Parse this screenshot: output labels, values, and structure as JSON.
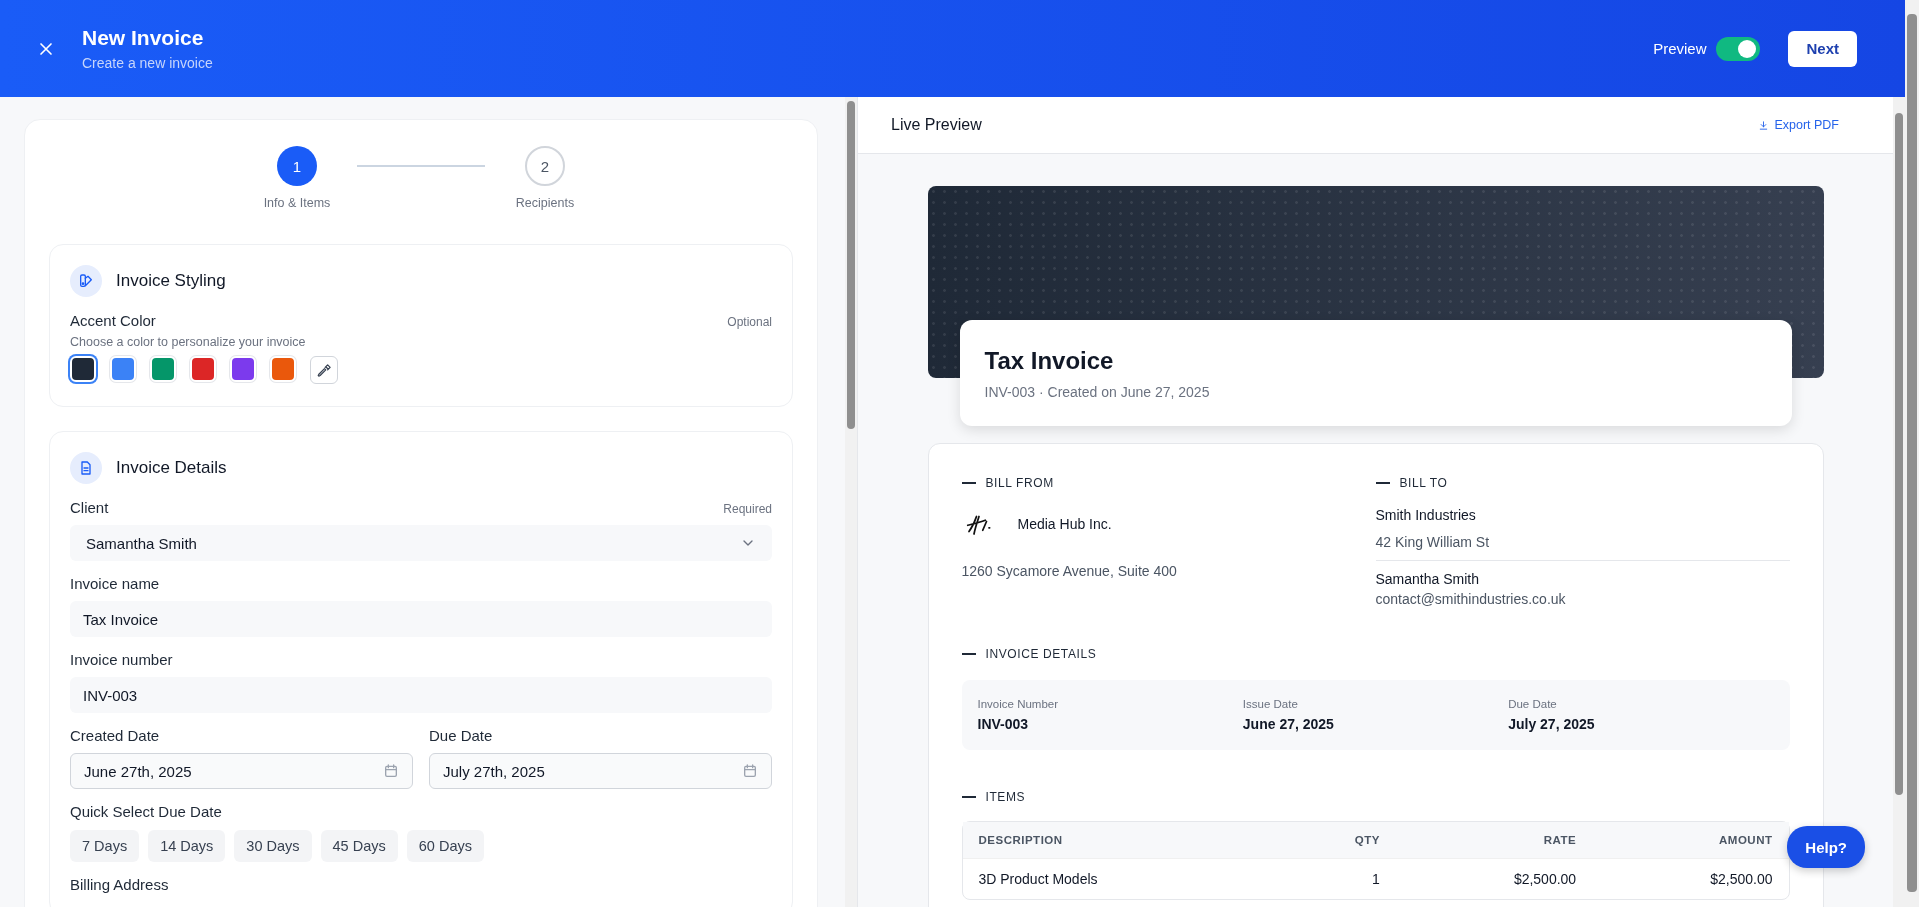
{
  "header": {
    "title": "New Invoice",
    "subtitle": "Create a new invoice",
    "preview_label": "Preview",
    "preview_on": true,
    "next_button": "Next"
  },
  "steps": [
    {
      "number": "1",
      "label": "Info & Items",
      "selected": true
    },
    {
      "number": "2",
      "label": "Recipients",
      "selected": false
    }
  ],
  "styling": {
    "title": "Invoice Styling",
    "accent_label": "Accent Color",
    "accent_note": "Optional",
    "accent_hint": "Choose a color to personalize your invoice",
    "swatches": [
      {
        "kind": "color",
        "color": "#1f2937",
        "selected": true
      },
      {
        "kind": "color",
        "color": "#3b82f6",
        "selected": false
      },
      {
        "kind": "color",
        "color": "#059669",
        "selected": false
      },
      {
        "kind": "color",
        "color": "#dc2626",
        "selected": false
      },
      {
        "kind": "color",
        "color": "#7c3aed",
        "selected": false
      },
      {
        "kind": "color",
        "color": "#ea580c",
        "selected": false
      },
      {
        "kind": "picker",
        "selected": false
      }
    ]
  },
  "details": {
    "title": "Invoice Details",
    "client": {
      "label": "Client",
      "note": "Required",
      "value": "Samantha Smith"
    },
    "invoice_name": {
      "label": "Invoice name",
      "value": "Tax Invoice"
    },
    "invoice_number": {
      "label": "Invoice number",
      "value": "INV-003"
    },
    "created_date": {
      "label": "Created Date",
      "value": "June 27th, 2025"
    },
    "due_date": {
      "label": "Due Date",
      "value": "July 27th, 2025"
    },
    "quick_select": {
      "label": "Quick Select Due Date",
      "options": [
        "7 Days",
        "14 Days",
        "30 Days",
        "45 Days",
        "60 Days"
      ]
    },
    "billing_address": {
      "label": "Billing Address"
    }
  },
  "preview": {
    "title": "Live Preview",
    "export": "Export PDF",
    "invoice_title": "Tax Invoice",
    "invoice_meta": "INV-003 · Created on June 27, 2025",
    "bill_from": {
      "heading": "BILL FROM",
      "company": "Media Hub Inc.",
      "address": "1260 Sycamore Avenue, Suite 400"
    },
    "bill_to": {
      "heading": "BILL TO",
      "company": "Smith Industries",
      "address": "42 King William St",
      "contact_name": "Samantha Smith",
      "contact_email": "contact@smithindustries.co.uk"
    },
    "invoice_details": {
      "heading": "INVOICE DETAILS",
      "fields": [
        {
          "label": "Invoice Number",
          "value": "INV-003"
        },
        {
          "label": "Issue Date",
          "value": "June 27, 2025"
        },
        {
          "label": "Due Date",
          "value": "July 27, 2025"
        }
      ]
    },
    "items": {
      "heading": "ITEMS",
      "columns": [
        "DESCRIPTION",
        "QTY",
        "RATE",
        "AMOUNT"
      ],
      "rows": [
        [
          "3D Product Models",
          "1",
          "$2,500.00",
          "$2,500.00"
        ]
      ]
    }
  },
  "help_button": "Help?"
}
